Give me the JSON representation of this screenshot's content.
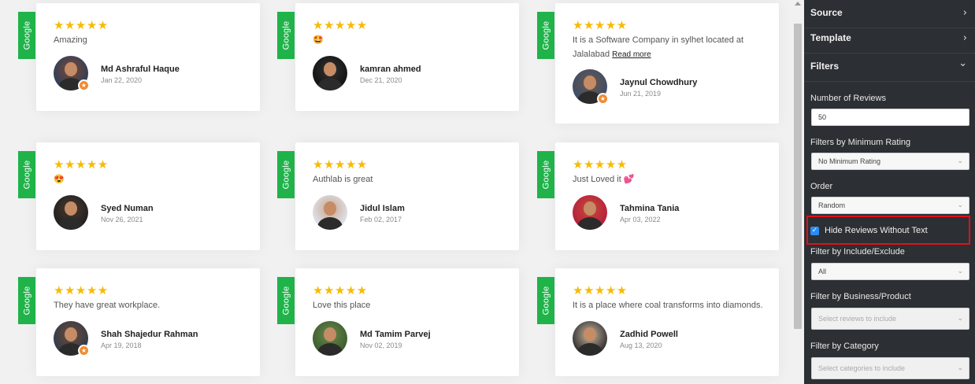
{
  "badge_label": "Google",
  "stars": "★★★★★",
  "read_more": "Read more",
  "reviews": [
    {
      "text": "Amazing",
      "name": "Md Ashraful Haque",
      "date": "Jan 22, 2020",
      "badge": true
    },
    {
      "text": "🤩",
      "name": "kamran ahmed",
      "date": "Dec 21, 2020",
      "badge": false
    },
    {
      "text": "It is a Software Company in sylhet located at Jalalabad",
      "name": "Jaynul Chowdhury",
      "date": "Jun 21, 2019",
      "badge": true,
      "read_more": true
    },
    {
      "text": "😍",
      "name": "Syed Numan",
      "date": "Nov 26, 2021",
      "badge": false
    },
    {
      "text": "Authlab is great",
      "name": "Jidul Islam",
      "date": "Feb 02, 2017",
      "badge": false
    },
    {
      "text": "Just Loved it 💕",
      "name": "Tahmina Tania",
      "date": "Apr 03, 2022",
      "badge": false
    },
    {
      "text": "They have great workplace.",
      "name": "Shah Shajedur Rahman",
      "date": "Apr 19, 2018",
      "badge": true
    },
    {
      "text": "Love this place",
      "name": "Md Tamim Parvej",
      "date": "Nov 02, 2019",
      "badge": false
    },
    {
      "text": "It is a place where coal transforms into diamonds.",
      "name": "Zadhid Powell",
      "date": "Aug 13, 2020",
      "badge": false
    }
  ],
  "sidebar": {
    "sections": [
      {
        "title": "Source",
        "chevron": "›"
      },
      {
        "title": "Template",
        "chevron": "›"
      },
      {
        "title": "Filters",
        "chevron": "⌄"
      }
    ],
    "number_of_reviews": {
      "label": "Number of Reviews",
      "value": "50"
    },
    "min_rating": {
      "label": "Filters by Minimum Rating",
      "value": "No Minimum Rating"
    },
    "order": {
      "label": "Order",
      "value": "Random"
    },
    "hide_without_text": {
      "label": "Hide Reviews Without Text",
      "checked": true
    },
    "include_exclude": {
      "label": "Filter by Include/Exclude",
      "value": "All"
    },
    "business": {
      "label": "Filter by Business/Product",
      "placeholder": "Select reviews to include"
    },
    "category": {
      "label": "Filter by Category",
      "placeholder": "Select categories to include"
    }
  },
  "colors": {
    "google_green": "#1fb34a",
    "star_gold": "#f6bb06",
    "sidebar_bg": "#2c2f33",
    "highlight_red": "#e0101a",
    "checkbox_blue": "#2a8bf2"
  }
}
